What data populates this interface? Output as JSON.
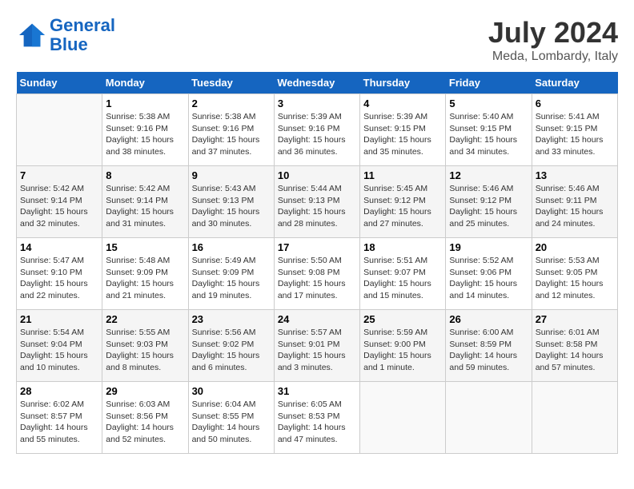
{
  "header": {
    "logo_line1": "General",
    "logo_line2": "Blue",
    "month_title": "July 2024",
    "location": "Meda, Lombardy, Italy"
  },
  "weekdays": [
    "Sunday",
    "Monday",
    "Tuesday",
    "Wednesday",
    "Thursday",
    "Friday",
    "Saturday"
  ],
  "weeks": [
    [
      {
        "day": "",
        "sunrise": "",
        "sunset": "",
        "daylight": ""
      },
      {
        "day": "1",
        "sunrise": "Sunrise: 5:38 AM",
        "sunset": "Sunset: 9:16 PM",
        "daylight": "Daylight: 15 hours and 38 minutes."
      },
      {
        "day": "2",
        "sunrise": "Sunrise: 5:38 AM",
        "sunset": "Sunset: 9:16 PM",
        "daylight": "Daylight: 15 hours and 37 minutes."
      },
      {
        "day": "3",
        "sunrise": "Sunrise: 5:39 AM",
        "sunset": "Sunset: 9:16 PM",
        "daylight": "Daylight: 15 hours and 36 minutes."
      },
      {
        "day": "4",
        "sunrise": "Sunrise: 5:39 AM",
        "sunset": "Sunset: 9:15 PM",
        "daylight": "Daylight: 15 hours and 35 minutes."
      },
      {
        "day": "5",
        "sunrise": "Sunrise: 5:40 AM",
        "sunset": "Sunset: 9:15 PM",
        "daylight": "Daylight: 15 hours and 34 minutes."
      },
      {
        "day": "6",
        "sunrise": "Sunrise: 5:41 AM",
        "sunset": "Sunset: 9:15 PM",
        "daylight": "Daylight: 15 hours and 33 minutes."
      }
    ],
    [
      {
        "day": "7",
        "sunrise": "Sunrise: 5:42 AM",
        "sunset": "Sunset: 9:14 PM",
        "daylight": "Daylight: 15 hours and 32 minutes."
      },
      {
        "day": "8",
        "sunrise": "Sunrise: 5:42 AM",
        "sunset": "Sunset: 9:14 PM",
        "daylight": "Daylight: 15 hours and 31 minutes."
      },
      {
        "day": "9",
        "sunrise": "Sunrise: 5:43 AM",
        "sunset": "Sunset: 9:13 PM",
        "daylight": "Daylight: 15 hours and 30 minutes."
      },
      {
        "day": "10",
        "sunrise": "Sunrise: 5:44 AM",
        "sunset": "Sunset: 9:13 PM",
        "daylight": "Daylight: 15 hours and 28 minutes."
      },
      {
        "day": "11",
        "sunrise": "Sunrise: 5:45 AM",
        "sunset": "Sunset: 9:12 PM",
        "daylight": "Daylight: 15 hours and 27 minutes."
      },
      {
        "day": "12",
        "sunrise": "Sunrise: 5:46 AM",
        "sunset": "Sunset: 9:12 PM",
        "daylight": "Daylight: 15 hours and 25 minutes."
      },
      {
        "day": "13",
        "sunrise": "Sunrise: 5:46 AM",
        "sunset": "Sunset: 9:11 PM",
        "daylight": "Daylight: 15 hours and 24 minutes."
      }
    ],
    [
      {
        "day": "14",
        "sunrise": "Sunrise: 5:47 AM",
        "sunset": "Sunset: 9:10 PM",
        "daylight": "Daylight: 15 hours and 22 minutes."
      },
      {
        "day": "15",
        "sunrise": "Sunrise: 5:48 AM",
        "sunset": "Sunset: 9:09 PM",
        "daylight": "Daylight: 15 hours and 21 minutes."
      },
      {
        "day": "16",
        "sunrise": "Sunrise: 5:49 AM",
        "sunset": "Sunset: 9:09 PM",
        "daylight": "Daylight: 15 hours and 19 minutes."
      },
      {
        "day": "17",
        "sunrise": "Sunrise: 5:50 AM",
        "sunset": "Sunset: 9:08 PM",
        "daylight": "Daylight: 15 hours and 17 minutes."
      },
      {
        "day": "18",
        "sunrise": "Sunrise: 5:51 AM",
        "sunset": "Sunset: 9:07 PM",
        "daylight": "Daylight: 15 hours and 15 minutes."
      },
      {
        "day": "19",
        "sunrise": "Sunrise: 5:52 AM",
        "sunset": "Sunset: 9:06 PM",
        "daylight": "Daylight: 15 hours and 14 minutes."
      },
      {
        "day": "20",
        "sunrise": "Sunrise: 5:53 AM",
        "sunset": "Sunset: 9:05 PM",
        "daylight": "Daylight: 15 hours and 12 minutes."
      }
    ],
    [
      {
        "day": "21",
        "sunrise": "Sunrise: 5:54 AM",
        "sunset": "Sunset: 9:04 PM",
        "daylight": "Daylight: 15 hours and 10 minutes."
      },
      {
        "day": "22",
        "sunrise": "Sunrise: 5:55 AM",
        "sunset": "Sunset: 9:03 PM",
        "daylight": "Daylight: 15 hours and 8 minutes."
      },
      {
        "day": "23",
        "sunrise": "Sunrise: 5:56 AM",
        "sunset": "Sunset: 9:02 PM",
        "daylight": "Daylight: 15 hours and 6 minutes."
      },
      {
        "day": "24",
        "sunrise": "Sunrise: 5:57 AM",
        "sunset": "Sunset: 9:01 PM",
        "daylight": "Daylight: 15 hours and 3 minutes."
      },
      {
        "day": "25",
        "sunrise": "Sunrise: 5:59 AM",
        "sunset": "Sunset: 9:00 PM",
        "daylight": "Daylight: 15 hours and 1 minute."
      },
      {
        "day": "26",
        "sunrise": "Sunrise: 6:00 AM",
        "sunset": "Sunset: 8:59 PM",
        "daylight": "Daylight: 14 hours and 59 minutes."
      },
      {
        "day": "27",
        "sunrise": "Sunrise: 6:01 AM",
        "sunset": "Sunset: 8:58 PM",
        "daylight": "Daylight: 14 hours and 57 minutes."
      }
    ],
    [
      {
        "day": "28",
        "sunrise": "Sunrise: 6:02 AM",
        "sunset": "Sunset: 8:57 PM",
        "daylight": "Daylight: 14 hours and 55 minutes."
      },
      {
        "day": "29",
        "sunrise": "Sunrise: 6:03 AM",
        "sunset": "Sunset: 8:56 PM",
        "daylight": "Daylight: 14 hours and 52 minutes."
      },
      {
        "day": "30",
        "sunrise": "Sunrise: 6:04 AM",
        "sunset": "Sunset: 8:55 PM",
        "daylight": "Daylight: 14 hours and 50 minutes."
      },
      {
        "day": "31",
        "sunrise": "Sunrise: 6:05 AM",
        "sunset": "Sunset: 8:53 PM",
        "daylight": "Daylight: 14 hours and 47 minutes."
      },
      {
        "day": "",
        "sunrise": "",
        "sunset": "",
        "daylight": ""
      },
      {
        "day": "",
        "sunrise": "",
        "sunset": "",
        "daylight": ""
      },
      {
        "day": "",
        "sunrise": "",
        "sunset": "",
        "daylight": ""
      }
    ]
  ]
}
